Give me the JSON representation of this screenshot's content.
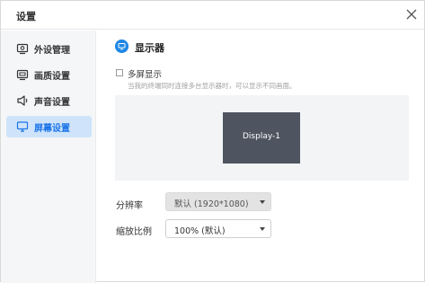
{
  "window": {
    "title": "设置"
  },
  "sidebar": {
    "items": [
      {
        "label": "外设管理",
        "icon": "peripheral-icon",
        "active": false
      },
      {
        "label": "画质设置",
        "icon": "image-quality-icon",
        "active": false
      },
      {
        "label": "声音设置",
        "icon": "speaker-icon",
        "active": false
      },
      {
        "label": "屏幕设置",
        "icon": "monitor-icon",
        "active": true
      }
    ]
  },
  "content": {
    "section_title": "显示器",
    "multi_screen": {
      "label": "多屏显示",
      "checked": false,
      "hint": "当我的终端同时连接多台显示器时，可以显示不同画面。"
    },
    "preview": {
      "display_label": "Display-1"
    },
    "resolution": {
      "label": "分辨率",
      "value": "默认 (1920*1080)",
      "disabled": true
    },
    "scale": {
      "label": "缩放比例",
      "value": "100% (默认)",
      "disabled": false
    }
  },
  "colors": {
    "accent": "#1e88e5",
    "active_bg": "#cfe4fb",
    "monitor": "#4e5560"
  }
}
